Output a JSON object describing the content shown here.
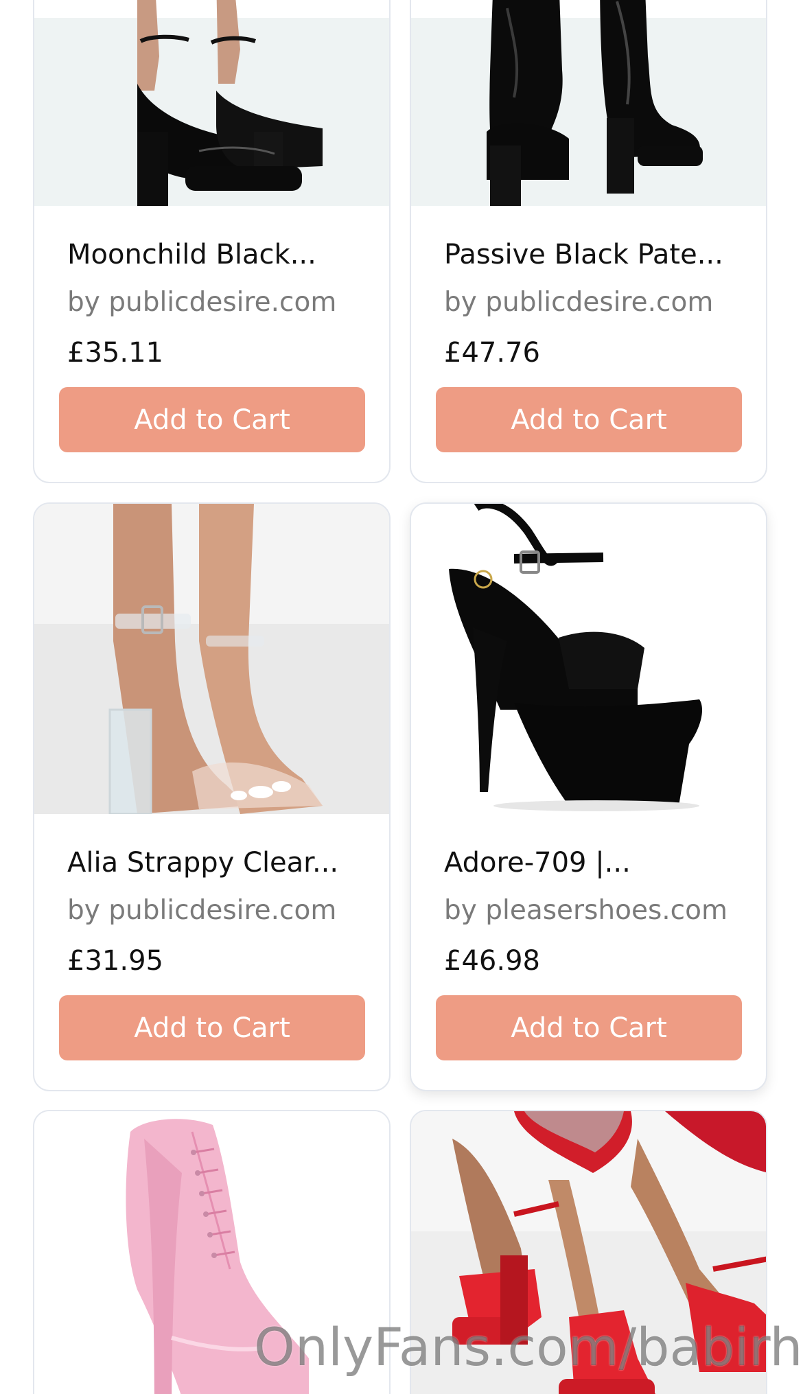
{
  "products": [
    {
      "title": "Moonchild Black...",
      "seller": "by publicdesire.com",
      "price": "£35.11",
      "button": "Add to Cart",
      "image": "black-patent-platform-heels"
    },
    {
      "title": "Passive Black Pate...",
      "seller": "by publicdesire.com",
      "price": "£47.76",
      "button": "Add to Cart",
      "image": "black-patent-platform-boots"
    },
    {
      "title": "Alia Strappy Clear...",
      "seller": "by publicdesire.com",
      "price": "£31.95",
      "button": "Add to Cart",
      "image": "clear-strappy-block-heels"
    },
    {
      "title": "Adore-709 |...",
      "seller": "by pleasershoes.com",
      "price": "£46.98",
      "button": "Add to Cart",
      "image": "black-platform-stiletto-sandal"
    },
    {
      "image": "pink-patent-lace-up-boot"
    },
    {
      "image": "red-satin-platform-heels"
    }
  ],
  "watermark": "OnlyFans.com/babirhi",
  "colors": {
    "button": "#ee9c84",
    "card_border": "#e3e7ee",
    "seller_text": "#7a7a7a"
  }
}
